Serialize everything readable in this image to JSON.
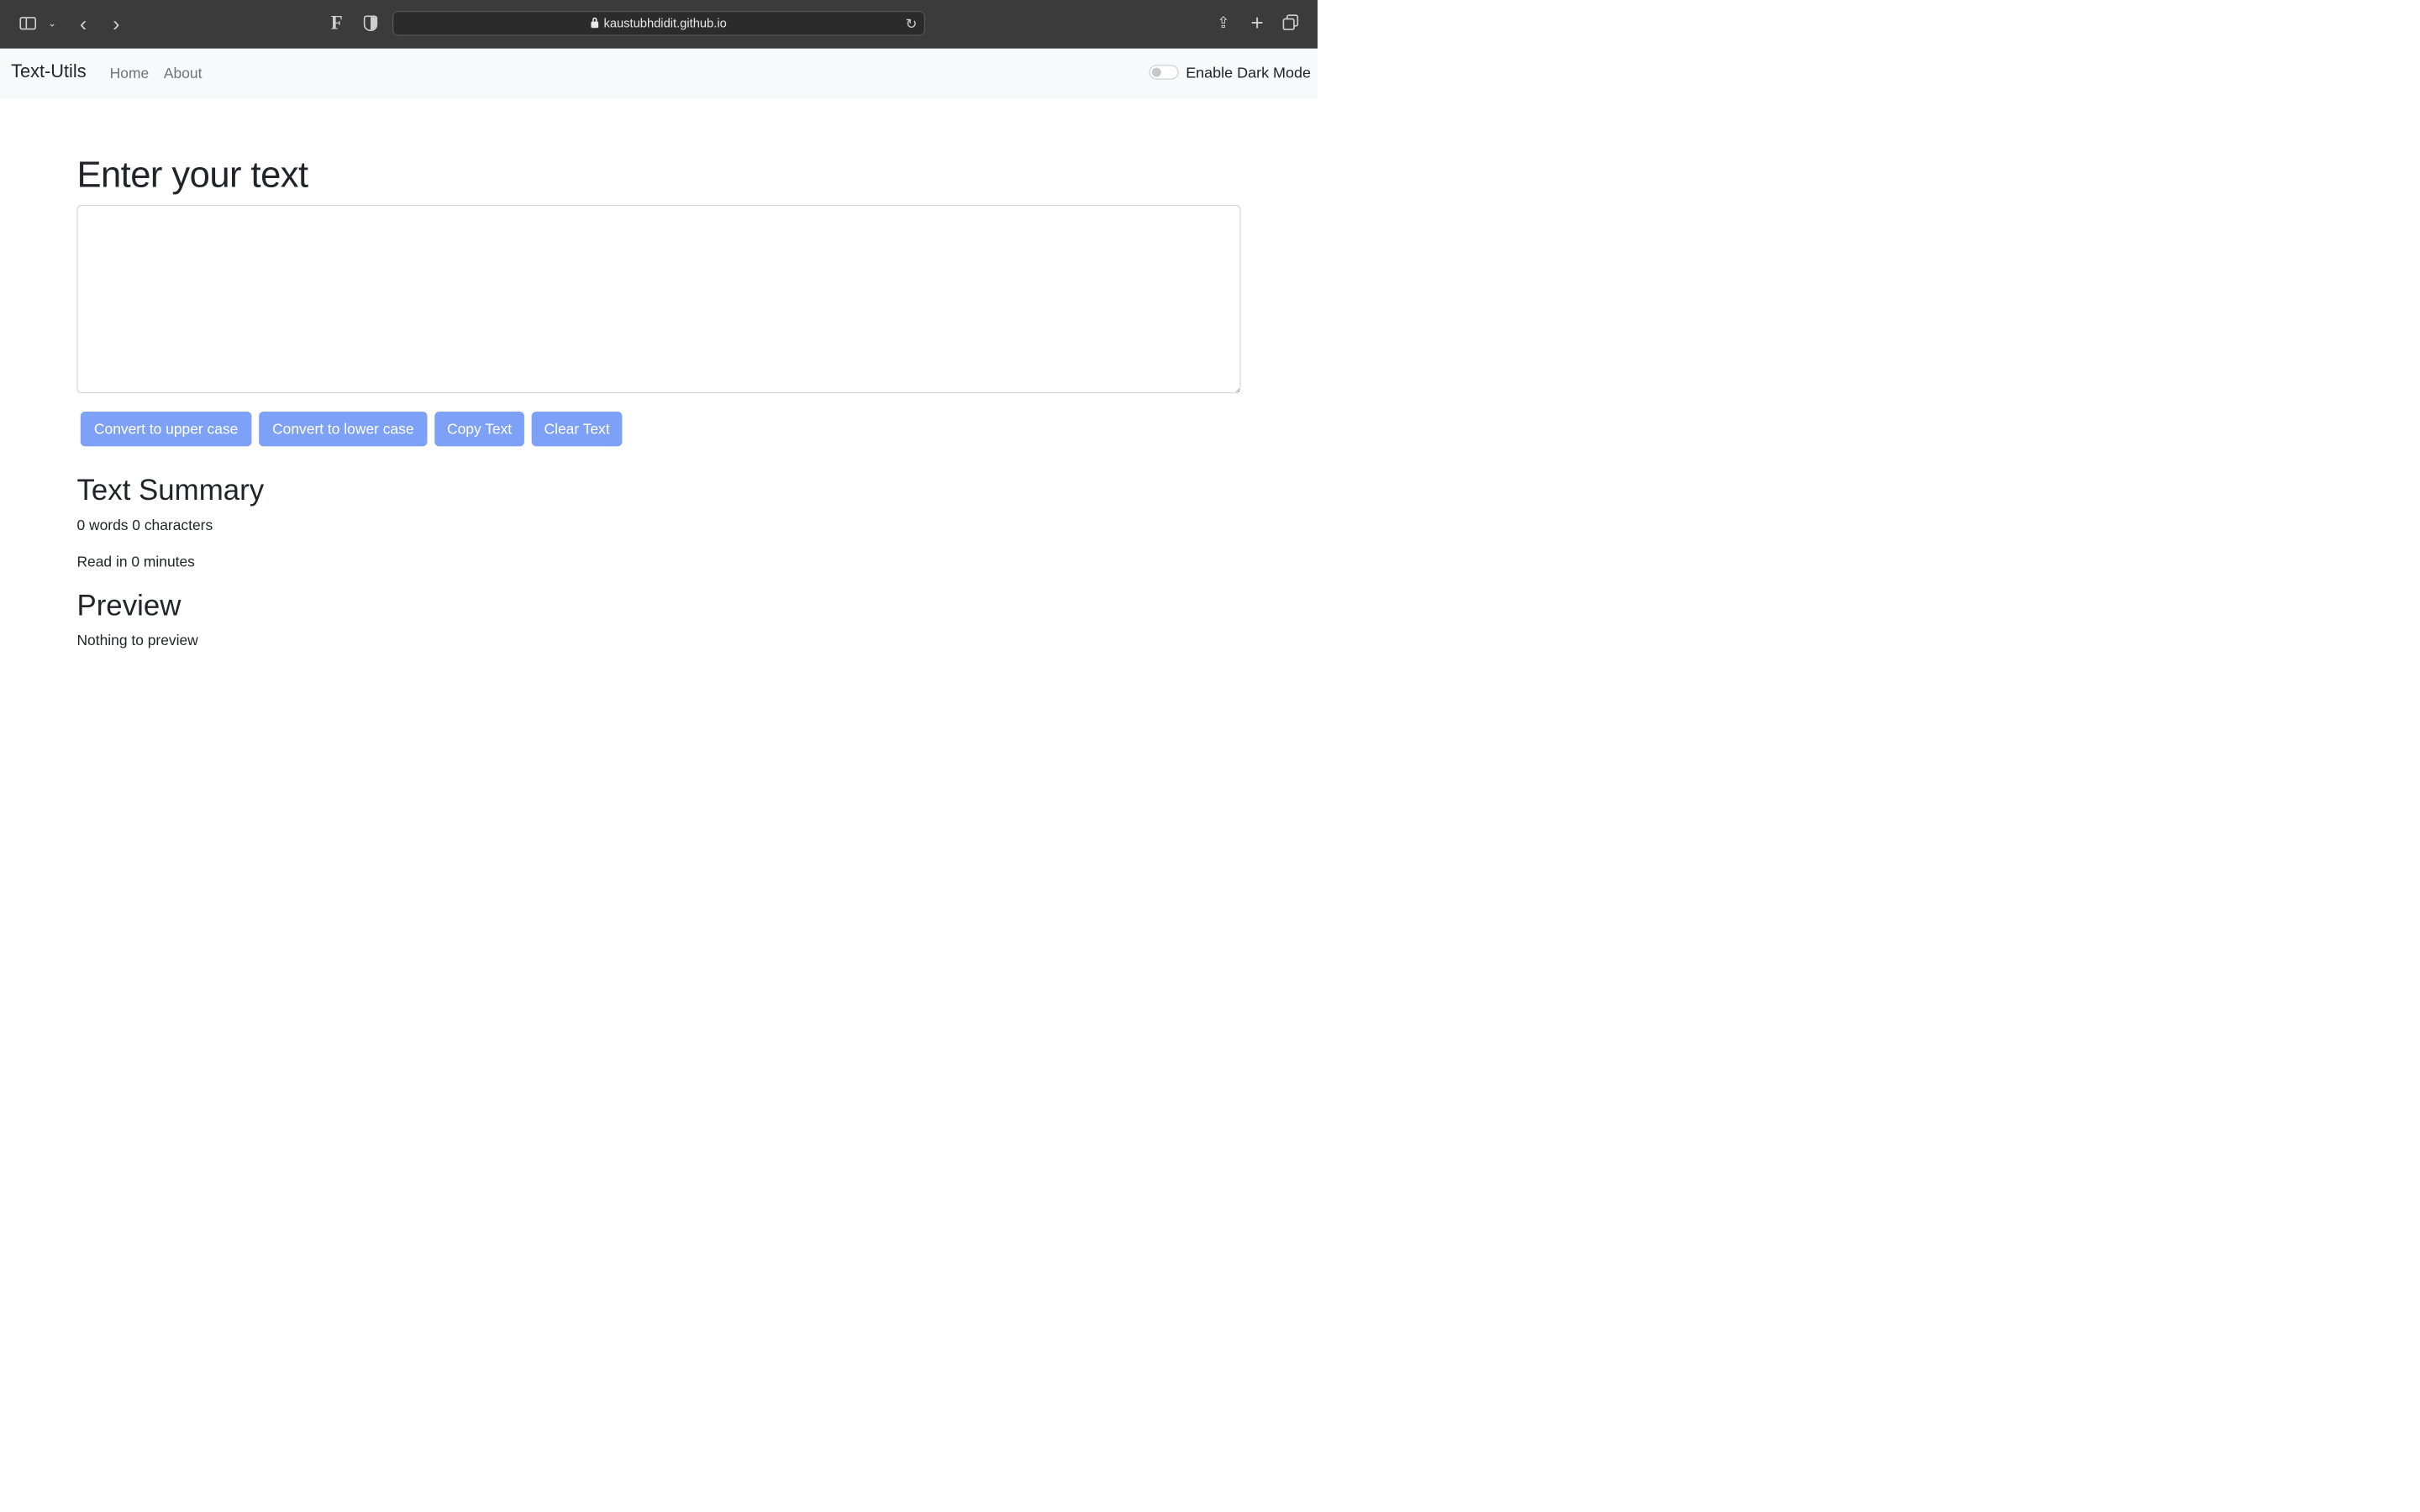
{
  "browser": {
    "url": "kaustubhdidit.github.io",
    "icons": {
      "sidebar": "sidebar-icon",
      "chevron": "chevron-down-icon",
      "back": "back-arrow-icon",
      "forward": "forward-arrow-icon",
      "reader": "reader-icon",
      "privacy": "shield-icon",
      "lock": "lock-icon",
      "reload": "reload-icon",
      "share": "share-icon",
      "new_tab": "plus-icon",
      "tabs": "tab-overview-icon"
    },
    "glyphs": {
      "chevron": "⌄",
      "back": "‹",
      "forward": "›",
      "reader": "F",
      "reload": "↻",
      "share": "⇪",
      "new_tab": "+"
    }
  },
  "navbar": {
    "brand": "Text-Utils",
    "links": [
      "Home",
      "About"
    ],
    "dark_mode_label": "Enable Dark Mode",
    "dark_mode_enabled": false
  },
  "main": {
    "heading": "Enter your text",
    "textarea_value": "",
    "buttons": {
      "upper": "Convert to upper case",
      "lower": "Convert to lower case",
      "copy": "Copy Text",
      "clear": "Clear Text"
    },
    "button_color": "#7ea1f8"
  },
  "summary": {
    "title": "Text Summary",
    "counts": "0 words 0 characters",
    "read_time": "Read in 0 minutes"
  },
  "preview": {
    "title": "Preview",
    "text": "Nothing to preview"
  }
}
